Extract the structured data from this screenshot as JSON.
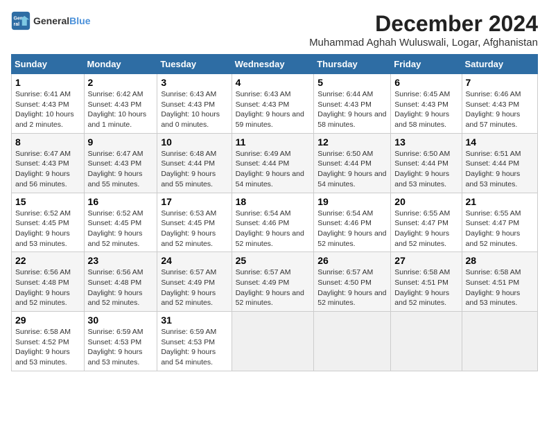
{
  "header": {
    "logo_general": "General",
    "logo_blue": "Blue",
    "title": "December 2024",
    "subtitle": "Muhammad Aghah Wuluswali, Logar, Afghanistan"
  },
  "calendar": {
    "days_of_week": [
      "Sunday",
      "Monday",
      "Tuesday",
      "Wednesday",
      "Thursday",
      "Friday",
      "Saturday"
    ],
    "weeks": [
      [
        {
          "day": "1",
          "sunrise": "6:41 AM",
          "sunset": "4:43 PM",
          "daylight": "10 hours and 2 minutes."
        },
        {
          "day": "2",
          "sunrise": "6:42 AM",
          "sunset": "4:43 PM",
          "daylight": "10 hours and 1 minute."
        },
        {
          "day": "3",
          "sunrise": "6:43 AM",
          "sunset": "4:43 PM",
          "daylight": "10 hours and 0 minutes."
        },
        {
          "day": "4",
          "sunrise": "6:43 AM",
          "sunset": "4:43 PM",
          "daylight": "9 hours and 59 minutes."
        },
        {
          "day": "5",
          "sunrise": "6:44 AM",
          "sunset": "4:43 PM",
          "daylight": "9 hours and 58 minutes."
        },
        {
          "day": "6",
          "sunrise": "6:45 AM",
          "sunset": "4:43 PM",
          "daylight": "9 hours and 58 minutes."
        },
        {
          "day": "7",
          "sunrise": "6:46 AM",
          "sunset": "4:43 PM",
          "daylight": "9 hours and 57 minutes."
        }
      ],
      [
        {
          "day": "8",
          "sunrise": "6:47 AM",
          "sunset": "4:43 PM",
          "daylight": "9 hours and 56 minutes."
        },
        {
          "day": "9",
          "sunrise": "6:47 AM",
          "sunset": "4:43 PM",
          "daylight": "9 hours and 55 minutes."
        },
        {
          "day": "10",
          "sunrise": "6:48 AM",
          "sunset": "4:44 PM",
          "daylight": "9 hours and 55 minutes."
        },
        {
          "day": "11",
          "sunrise": "6:49 AM",
          "sunset": "4:44 PM",
          "daylight": "9 hours and 54 minutes."
        },
        {
          "day": "12",
          "sunrise": "6:50 AM",
          "sunset": "4:44 PM",
          "daylight": "9 hours and 54 minutes."
        },
        {
          "day": "13",
          "sunrise": "6:50 AM",
          "sunset": "4:44 PM",
          "daylight": "9 hours and 53 minutes."
        },
        {
          "day": "14",
          "sunrise": "6:51 AM",
          "sunset": "4:44 PM",
          "daylight": "9 hours and 53 minutes."
        }
      ],
      [
        {
          "day": "15",
          "sunrise": "6:52 AM",
          "sunset": "4:45 PM",
          "daylight": "9 hours and 53 minutes."
        },
        {
          "day": "16",
          "sunrise": "6:52 AM",
          "sunset": "4:45 PM",
          "daylight": "9 hours and 52 minutes."
        },
        {
          "day": "17",
          "sunrise": "6:53 AM",
          "sunset": "4:45 PM",
          "daylight": "9 hours and 52 minutes."
        },
        {
          "day": "18",
          "sunrise": "6:54 AM",
          "sunset": "4:46 PM",
          "daylight": "9 hours and 52 minutes."
        },
        {
          "day": "19",
          "sunrise": "6:54 AM",
          "sunset": "4:46 PM",
          "daylight": "9 hours and 52 minutes."
        },
        {
          "day": "20",
          "sunrise": "6:55 AM",
          "sunset": "4:47 PM",
          "daylight": "9 hours and 52 minutes."
        },
        {
          "day": "21",
          "sunrise": "6:55 AM",
          "sunset": "4:47 PM",
          "daylight": "9 hours and 52 minutes."
        }
      ],
      [
        {
          "day": "22",
          "sunrise": "6:56 AM",
          "sunset": "4:48 PM",
          "daylight": "9 hours and 52 minutes."
        },
        {
          "day": "23",
          "sunrise": "6:56 AM",
          "sunset": "4:48 PM",
          "daylight": "9 hours and 52 minutes."
        },
        {
          "day": "24",
          "sunrise": "6:57 AM",
          "sunset": "4:49 PM",
          "daylight": "9 hours and 52 minutes."
        },
        {
          "day": "25",
          "sunrise": "6:57 AM",
          "sunset": "4:49 PM",
          "daylight": "9 hours and 52 minutes."
        },
        {
          "day": "26",
          "sunrise": "6:57 AM",
          "sunset": "4:50 PM",
          "daylight": "9 hours and 52 minutes."
        },
        {
          "day": "27",
          "sunrise": "6:58 AM",
          "sunset": "4:51 PM",
          "daylight": "9 hours and 52 minutes."
        },
        {
          "day": "28",
          "sunrise": "6:58 AM",
          "sunset": "4:51 PM",
          "daylight": "9 hours and 53 minutes."
        }
      ],
      [
        {
          "day": "29",
          "sunrise": "6:58 AM",
          "sunset": "4:52 PM",
          "daylight": "9 hours and 53 minutes."
        },
        {
          "day": "30",
          "sunrise": "6:59 AM",
          "sunset": "4:53 PM",
          "daylight": "9 hours and 53 minutes."
        },
        {
          "day": "31",
          "sunrise": "6:59 AM",
          "sunset": "4:53 PM",
          "daylight": "9 hours and 54 minutes."
        },
        null,
        null,
        null,
        null
      ]
    ]
  }
}
